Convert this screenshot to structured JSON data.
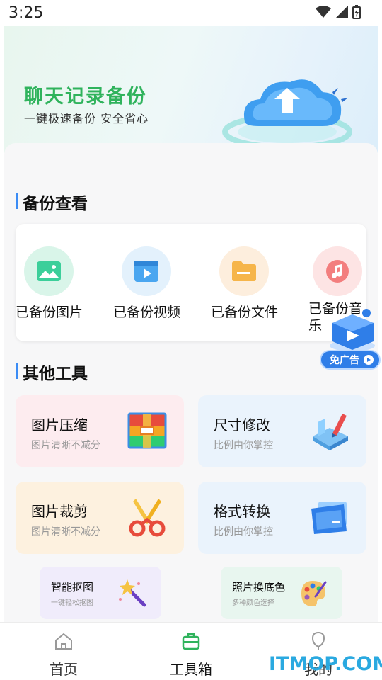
{
  "status_bar": {
    "time": "3:25"
  },
  "banner": {
    "title": "聊天记录备份",
    "subtitle": "一键极速备份 安全省心"
  },
  "backup_section": {
    "title": "备份查看",
    "items": [
      {
        "label": "已备份图片",
        "icon": "image-icon",
        "color": "#d9f5e9"
      },
      {
        "label": "已备份视频",
        "icon": "video-icon",
        "color": "#e3f1fc"
      },
      {
        "label": "已备份文件",
        "icon": "folder-icon",
        "color": "#fdeedd"
      },
      {
        "label": "已备份音乐",
        "icon": "music-icon",
        "color": "#fde4e4"
      }
    ],
    "ad_badge": "免广告"
  },
  "tools_section": {
    "title": "其他工具",
    "cards": [
      {
        "title": "图片压缩",
        "subtitle": "图片清晰不减分",
        "icon": "compress-icon",
        "bg": "#fdecef"
      },
      {
        "title": "尺寸修改",
        "subtitle": "比例由你掌控",
        "icon": "resize-icon",
        "bg": "#eaf3fc"
      },
      {
        "title": "图片裁剪",
        "subtitle": "图片清晰不减分",
        "icon": "scissors-icon",
        "bg": "#fdf1df"
      },
      {
        "title": "格式转换",
        "subtitle": "比例由你掌控",
        "icon": "convert-icon",
        "bg": "#eaf3fc"
      }
    ],
    "mini_cards": [
      {
        "title": "智能抠图",
        "subtitle": "一键轻松抠图",
        "icon": "magic-wand-icon",
        "bg": "#f0ecfb"
      },
      {
        "title": "照片换底色",
        "subtitle": "多种颜色选择",
        "icon": "palette-icon",
        "bg": "#e8f6ef"
      }
    ]
  },
  "tab_bar": {
    "tabs": [
      {
        "label": "首页",
        "active": false
      },
      {
        "label": "工具箱",
        "active": true
      },
      {
        "label": "我的",
        "active": false
      }
    ],
    "active_color": "#2fb35c"
  },
  "watermark": "ITMOP.COM"
}
